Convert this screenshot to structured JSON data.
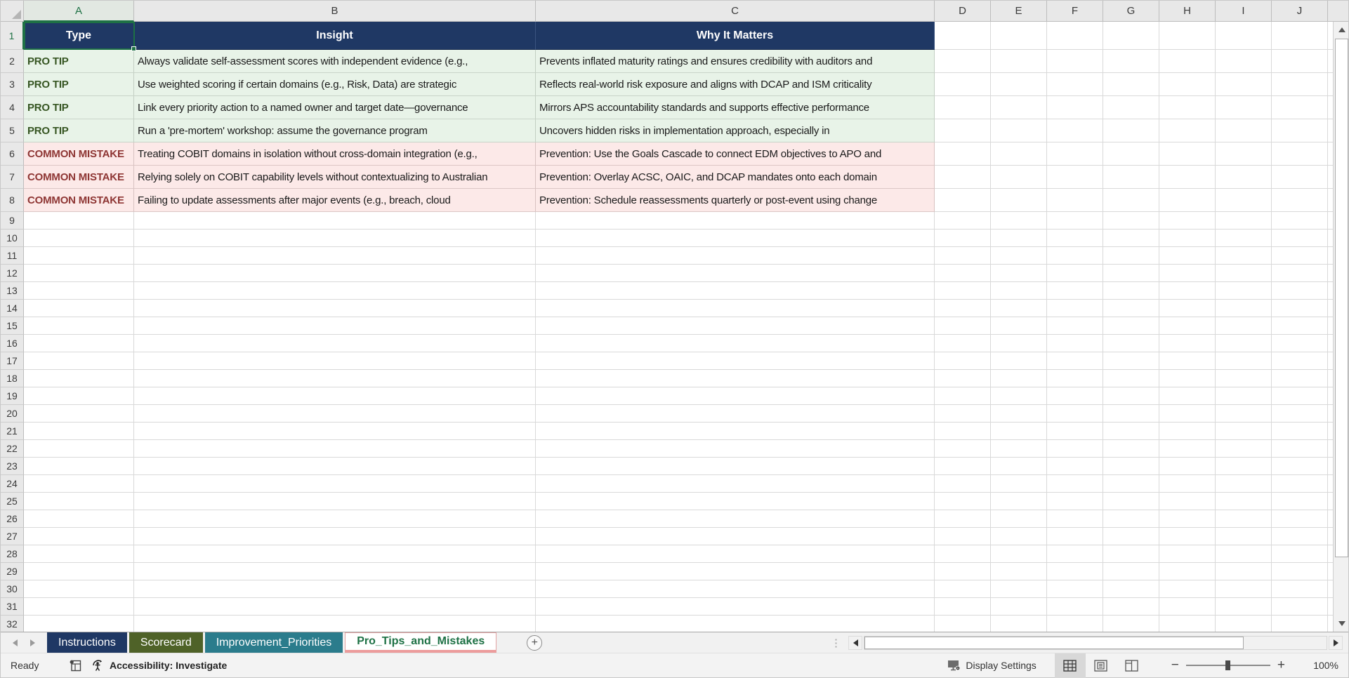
{
  "sheet": {
    "selected_cell": "A1",
    "selected_column": "A",
    "selected_row": "1",
    "column_letters": [
      "A",
      "B",
      "C",
      "D",
      "E",
      "F",
      "G",
      "H",
      "I",
      "J"
    ],
    "visible_row_count": 32,
    "header_row": {
      "type": "Type",
      "insight": "Insight",
      "why": "Why It Matters"
    },
    "rows": [
      {
        "kind": "protip",
        "type": "PRO TIP",
        "insight": "Always validate self-assessment scores with independent evidence (e.g.,",
        "why": "Prevents inflated maturity ratings and ensures credibility with auditors and"
      },
      {
        "kind": "protip",
        "type": "PRO TIP",
        "insight": "Use weighted scoring if certain domains (e.g., Risk, Data) are strategic",
        "why": "Reflects real-world risk exposure and aligns with DCAP and ISM criticality"
      },
      {
        "kind": "protip",
        "type": "PRO TIP",
        "insight": "Link every priority action to a named owner and target date—governance",
        "why": "Mirrors APS accountability standards and supports effective performance"
      },
      {
        "kind": "protip",
        "type": "PRO TIP",
        "insight": "Run a 'pre-mortem' workshop: assume the governance program",
        "why": "Uncovers hidden risks in implementation approach, especially in"
      },
      {
        "kind": "mistake",
        "type": "COMMON MISTAKE",
        "insight": "Treating COBIT domains in isolation without cross-domain integration (e.g.,",
        "why": "Prevention: Use the Goals Cascade to connect EDM objectives to APO and"
      },
      {
        "kind": "mistake",
        "type": "COMMON MISTAKE",
        "insight": "Relying solely on COBIT capability levels without contextualizing to Australian",
        "why": "Prevention: Overlay ACSC, OAIC, and DCAP mandates onto each domain"
      },
      {
        "kind": "mistake",
        "type": "COMMON MISTAKE",
        "insight": "Failing to update assessments after major events (e.g., breach, cloud",
        "why": "Prevention: Schedule reassessments quarterly or post-event using change"
      }
    ]
  },
  "tabs": [
    {
      "label": "Instructions",
      "color": "#1f3864",
      "active": false
    },
    {
      "label": "Scorecard",
      "color": "#4f6228",
      "active": false
    },
    {
      "label": "Improvement_Priorities",
      "color": "#2b7c8c",
      "active": false
    },
    {
      "label": "Pro_Tips_and_Mistakes",
      "color": "#ec9c9c",
      "active": true
    }
  ],
  "status_bar": {
    "ready_label": "Ready",
    "accessibility_label": "Accessibility: Investigate",
    "display_settings_label": "Display Settings",
    "zoom_level": "100%"
  },
  "colors": {
    "header_fill": "#1f3864",
    "protip_fill": "#e8f3e8",
    "protip_text": "#375623",
    "mistake_fill": "#fce9e8",
    "mistake_text": "#8e3634",
    "selection_accent": "#1e7145"
  }
}
